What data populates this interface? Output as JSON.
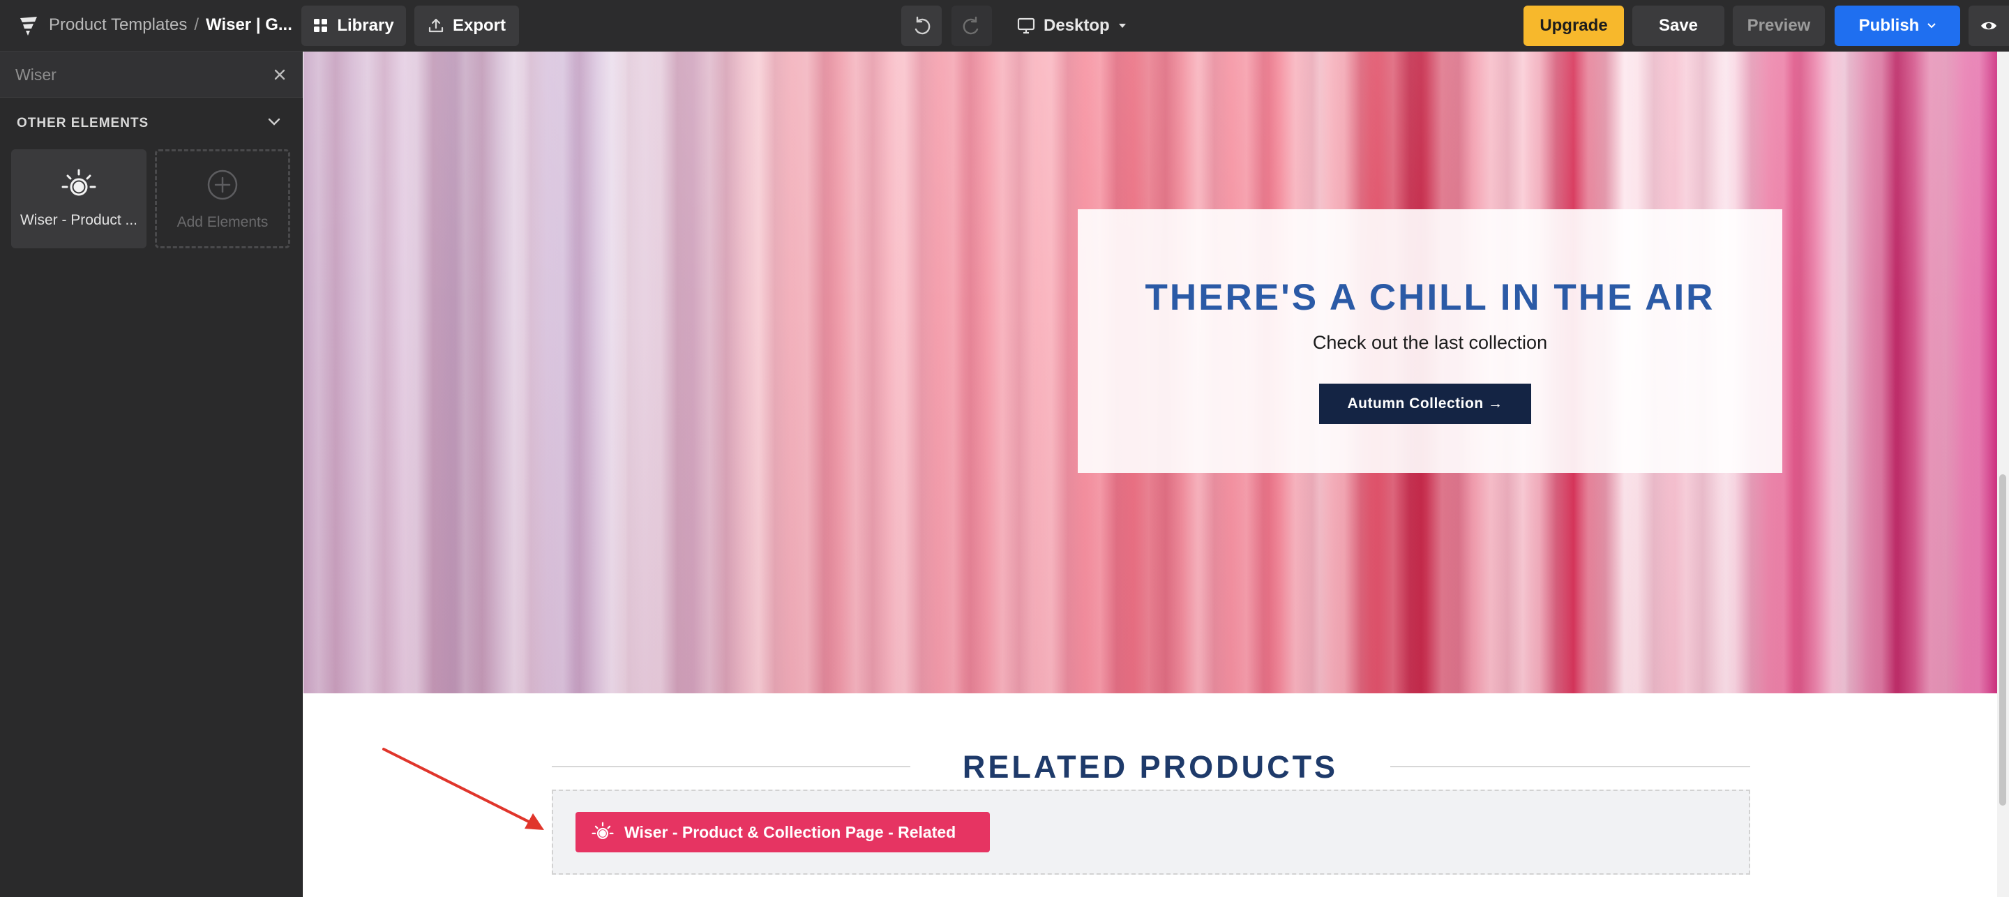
{
  "topbar": {
    "breadcrumb_root": "Product Templates",
    "breadcrumb_sep": "/",
    "breadcrumb_current": "Wiser | G...",
    "library_label": "Library",
    "export_label": "Export",
    "device_label": "Desktop",
    "upgrade_label": "Upgrade",
    "save_label": "Save",
    "preview_label": "Preview",
    "publish_label": "Publish"
  },
  "sidebar": {
    "search_value": "Wiser",
    "section_title": "OTHER ELEMENTS",
    "tiles": [
      {
        "label": "Wiser - Product ...",
        "icon": "wiser-sun-icon"
      },
      {
        "label": "Add Elements",
        "icon": "plus-circle-icon"
      }
    ]
  },
  "hero": {
    "title": "THERE'S A CHILL IN THE AIR",
    "subtitle": "Check out the last collection",
    "button_label": "Autumn Collection →"
  },
  "related": {
    "title": "RELATED PRODUCTS",
    "widget_label": "Wiser - Product & Collection Page - Related"
  },
  "colors": {
    "accent_publish": "#1f6ff0",
    "accent_upgrade": "#f7b82c",
    "wiser_chip": "#e63462",
    "hero_title": "#2b5aa6",
    "hero_button": "#142444",
    "annotation_arrow": "#e0352b"
  }
}
